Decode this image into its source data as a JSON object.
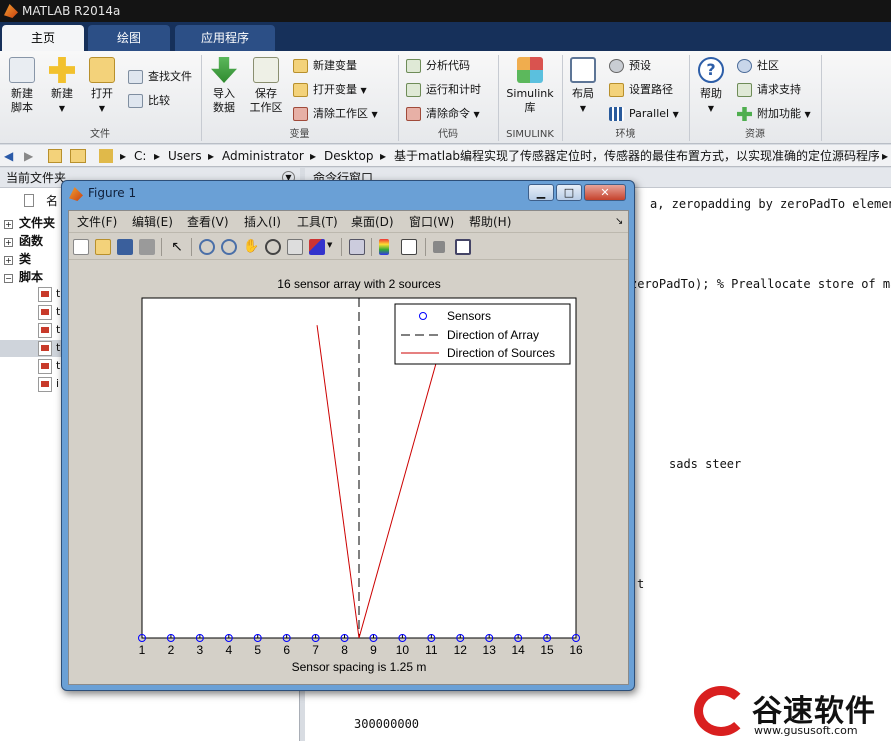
{
  "app": {
    "title": "MATLAB R2014a"
  },
  "tabs": [
    {
      "label": "主页"
    },
    {
      "label": "绘图"
    },
    {
      "label": "应用程序"
    }
  ],
  "ribbon": {
    "file": {
      "new_script": "新建\n脚本",
      "new": "新建",
      "open": "打开",
      "find_files": "查找文件",
      "compare": "比较",
      "group": "文件"
    },
    "variable": {
      "import": "导入\n数据",
      "save_ws": "保存\n工作区",
      "new_var": "新建变量",
      "open_var": "打开变量",
      "clear_ws": "清除工作区",
      "group": "变量"
    },
    "code": {
      "analyze": "分析代码",
      "run_time": "运行和计时",
      "clear_cmds": "清除命令",
      "group": "代码"
    },
    "simulink": {
      "lib": "Simulink\n库",
      "group": "SIMULINK"
    },
    "env": {
      "layout": "布局",
      "prefs": "预设",
      "set_path": "设置路径",
      "parallel": "Parallel",
      "group": "环境"
    },
    "resources": {
      "help": "帮助",
      "community": "社区",
      "support": "请求支持",
      "addons": "附加功能",
      "group": "资源"
    }
  },
  "address": {
    "parts": [
      "C:",
      "Users",
      "Administrator",
      "Desktop",
      "基于matlab编程实现了传感器定位时，传感器的最佳布置方式，以实现准确的定位源码程序"
    ]
  },
  "left_panel": {
    "title": "当前文件夹",
    "col_name": "名",
    "tree": [
      "文件夹",
      "函数",
      "类",
      "脚本"
    ],
    "file_letters": [
      "t",
      "t",
      "t",
      "t",
      "t",
      "i"
    ]
  },
  "command": {
    "title": "命令行窗口",
    "lines": [
      "a, zeropadding by zeroPadTo elements",
      "zeroPadTo); % Preallocate store of ma",
      "sads        steer",
      "t",
      "300000000"
    ]
  },
  "figure": {
    "title": "Figure 1",
    "menus": [
      "文件(F)",
      "编辑(E)",
      "查看(V)",
      "插入(I)",
      "工具(T)",
      "桌面(D)",
      "窗口(W)",
      "帮助(H)"
    ]
  },
  "chart_data": {
    "type": "line",
    "title": "16 sensor array with 2 sources",
    "xlabel": "Sensor spacing is 1.25 m",
    "ylabel": "",
    "xlim": [
      1,
      16
    ],
    "ylim": [
      0,
      1
    ],
    "x_ticks": [
      1,
      2,
      3,
      4,
      5,
      6,
      7,
      8,
      9,
      10,
      11,
      12,
      13,
      14,
      15,
      16
    ],
    "sensors": [
      1,
      2,
      3,
      4,
      5,
      6,
      7,
      8,
      9,
      10,
      11,
      12,
      13,
      14,
      15,
      16
    ],
    "array_direction_x": 8.5,
    "source_lines": [
      {
        "from": [
          8.5,
          0
        ],
        "to": [
          7.05,
          0.92
        ]
      },
      {
        "from": [
          8.5,
          0
        ],
        "to": [
          11.4,
          0.88
        ]
      }
    ],
    "legend": {
      "position": "top-right",
      "entries": [
        "Sensors",
        "Direction of Array",
        "Direction of Sources"
      ]
    },
    "colors": {
      "sensors": "#0000ff",
      "array": "#000000",
      "sources": "#cc0000"
    },
    "grid": false
  },
  "watermark": {
    "brand": "谷速软件",
    "url": "www.gususoft.com",
    "color": "#d91f1f"
  }
}
